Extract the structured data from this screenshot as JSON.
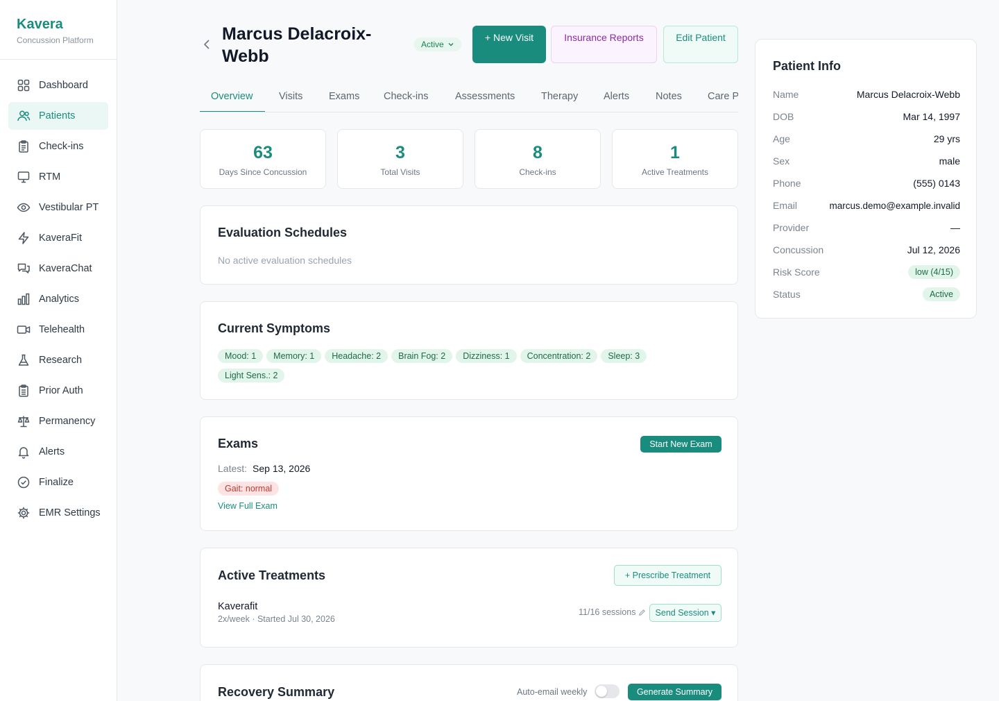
{
  "brand": {
    "name": "Kavera",
    "subtitle": "Concussion Platform"
  },
  "sidebar": {
    "items": [
      {
        "label": "Dashboard",
        "icon": "dashboard-icon"
      },
      {
        "label": "Patients",
        "icon": "users-icon",
        "active": true
      },
      {
        "label": "Check-ins",
        "icon": "clipboard-icon"
      },
      {
        "label": "RTM",
        "icon": "monitor-icon"
      },
      {
        "label": "Vestibular PT",
        "icon": "eye-icon"
      },
      {
        "label": "KaveraFit",
        "icon": "bolt-icon"
      },
      {
        "label": "KaveraChat",
        "icon": "chat-icon"
      },
      {
        "label": "Analytics",
        "icon": "bar-chart-icon"
      },
      {
        "label": "Telehealth",
        "icon": "video-icon"
      },
      {
        "label": "Research",
        "icon": "flask-icon"
      },
      {
        "label": "Prior Auth",
        "icon": "clipboard-check-icon"
      },
      {
        "label": "Permanency",
        "icon": "scale-icon"
      },
      {
        "label": "Alerts",
        "icon": "bell-icon"
      },
      {
        "label": "Finalize",
        "icon": "check-circle-icon"
      },
      {
        "label": "EMR Settings",
        "icon": "gear-icon"
      }
    ]
  },
  "header": {
    "patient_name": "Marcus Delacroix-Webb",
    "status": "Active",
    "new_visit": "+ New Visit",
    "insurance_reports": "Insurance Reports",
    "edit_patient": "Edit Patient"
  },
  "tabs": [
    "Overview",
    "Visits",
    "Exams",
    "Check-ins",
    "Assessments",
    "Therapy",
    "Alerts",
    "Notes",
    "Care P"
  ],
  "stats": [
    {
      "value": "63",
      "label": "Days Since Concussion"
    },
    {
      "value": "3",
      "label": "Total Visits"
    },
    {
      "value": "8",
      "label": "Check-ins"
    },
    {
      "value": "1",
      "label": "Active Treatments"
    }
  ],
  "evaluation": {
    "title": "Evaluation Schedules",
    "empty": "No active evaluation schedules"
  },
  "symptoms": {
    "title": "Current Symptoms",
    "items": [
      "Mood: 1",
      "Memory: 1",
      "Headache: 2",
      "Brain Fog: 2",
      "Dizziness: 1",
      "Concentration: 2",
      "Sleep: 3",
      "Light Sens.: 2"
    ]
  },
  "exams": {
    "title": "Exams",
    "start_button": "Start New Exam",
    "latest_label": "Latest:",
    "latest_date": "Sep 13, 2026",
    "gait": "Gait: normal",
    "view_link": "View Full Exam"
  },
  "treatments": {
    "title": "Active Treatments",
    "prescribe_button": "+ Prescribe Treatment",
    "item": {
      "name": "Kaverafit",
      "detail": "2x/week · Started Jul 30, 2026",
      "sessions": "11/16 sessions",
      "send_button": "Send Session ▾"
    }
  },
  "recovery": {
    "title": "Recovery Summary",
    "auto_email": "Auto-email weekly",
    "auto_email_on": false,
    "generate_button": "Generate Summary"
  },
  "patient_info": {
    "title": "Patient Info",
    "rows": [
      {
        "label": "Name",
        "value": "Marcus Delacroix-Webb"
      },
      {
        "label": "DOB",
        "value": "Mar 14, 1997"
      },
      {
        "label": "Age",
        "value": "29 yrs"
      },
      {
        "label": "Sex",
        "value": "male"
      },
      {
        "label": "Phone",
        "value": "(555) 0143"
      },
      {
        "label": "Email",
        "value": "marcus.demo@example.invalid"
      },
      {
        "label": "Provider",
        "value": "—"
      },
      {
        "label": "Concussion",
        "value": "Jul 12, 2026"
      },
      {
        "label": "Risk Score",
        "value": "low (4/15)",
        "badge": true
      },
      {
        "label": "Status",
        "value": "Active",
        "badge": true
      }
    ]
  },
  "colors": {
    "accent": "#1a8c7e",
    "chip_bg": "#e1f5ea",
    "gait_bg": "#fde3e3",
    "gait_text": "#c0392b",
    "insurance_text": "#8e2aa6"
  }
}
